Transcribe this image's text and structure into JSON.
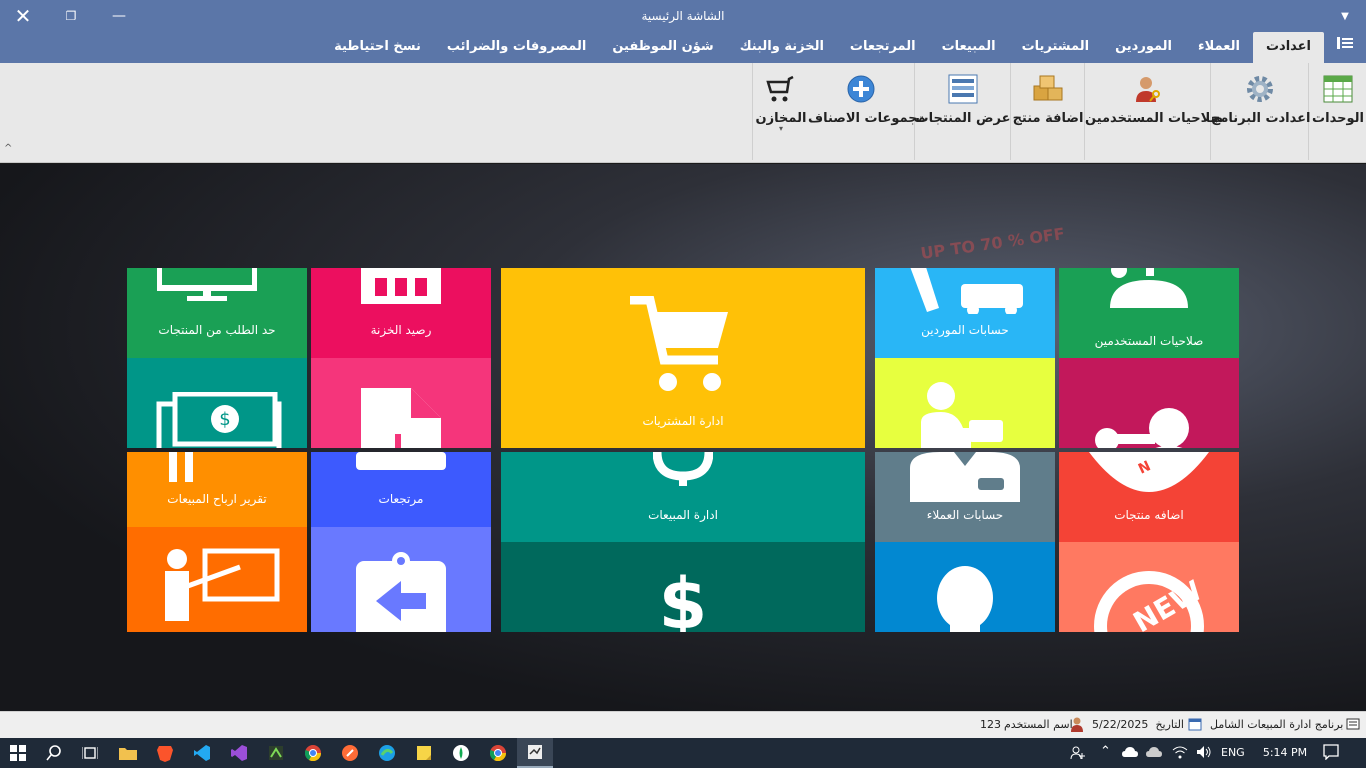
{
  "window": {
    "title": "الشاشة الرئيسية"
  },
  "menu": {
    "tabs": [
      "اعدادت",
      "العملاء",
      "الموردين",
      "المشتريات",
      "المبيعات",
      "المرتجعات",
      "الخزنة والبنك",
      "شؤن الموظفين",
      "المصروفات والضرائب",
      "نسخ احتياطية"
    ],
    "active_tab": "اعدادت"
  },
  "ribbon": {
    "items": [
      {
        "label": "الوحدات",
        "icon": "grid-table-icon"
      },
      {
        "label": "اعدادت البرنامج",
        "icon": "gear-icon"
      },
      {
        "label": "صلاحيات المستخدمين",
        "icon": "user-key-icon"
      },
      {
        "label": "اضافة منتج",
        "icon": "boxes-icon"
      },
      {
        "label": "عرض المنتجات",
        "icon": "list-icon"
      },
      {
        "label": "مجموعات الاصناف",
        "icon": "plus-circle-icon"
      },
      {
        "label": "المخازن",
        "icon": "cart-icon"
      }
    ]
  },
  "tiles": {
    "order_limit": "حد الطلب من المنتجات",
    "treasury_balance": "رصيد الخزنة",
    "purchases": "ادارة المشتريات",
    "supplier_accounts": "حسابات الموردين",
    "user_permissions": "صلاحيات المستخدمين",
    "profit_report": "تقرير ارباح المبيعات",
    "returns": "مرتجعات",
    "sales": "ادارة المبيعات",
    "customer_accounts": "حسابات العملاء",
    "add_products": "اضافه منتجات",
    "new_badge": "NEW"
  },
  "statusbar": {
    "app_name": "برنامج ادارة المبيعات الشامل",
    "date_label": "التاريخ",
    "date_value": "5/22/2025",
    "user_label": "اسم المستخدم",
    "user_value": "123"
  },
  "taskbar": {
    "language": "ENG",
    "time": "5:14 PM"
  },
  "background": {
    "banner_text": "UP TO 70 % OFF"
  }
}
